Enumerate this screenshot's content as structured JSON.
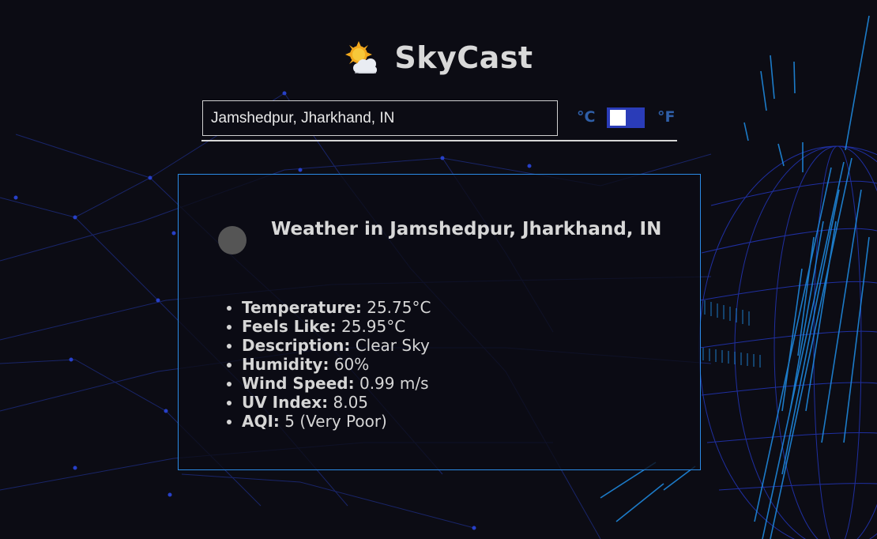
{
  "app": {
    "title": "SkyCast",
    "logo_icon": "sun-behind-cloud-icon"
  },
  "search": {
    "value": "Jamshedpur, Jharkhand, IN",
    "placeholder": ""
  },
  "units": {
    "celsius_label": "°C",
    "fahrenheit_label": "°F",
    "selected": "°C"
  },
  "weather": {
    "title": "Weather in Jamshedpur, Jharkhand, IN",
    "icon": "weather-condition-icon",
    "details": [
      {
        "label": "Temperature:",
        "value": "25.75°C"
      },
      {
        "label": "Feels Like:",
        "value": "25.95°C"
      },
      {
        "label": "Description:",
        "value": "Clear Sky"
      },
      {
        "label": "Humidity:",
        "value": "60%"
      },
      {
        "label": "Wind Speed:",
        "value": "0.99 m/s"
      },
      {
        "label": "UV Index:",
        "value": "8.05"
      },
      {
        "label": "AQI:",
        "value": "5 (Very Poor)"
      }
    ]
  },
  "colors": {
    "background": "#0c0c14",
    "accent": "#2b8be6",
    "toggle": "#2a3cb8",
    "unit_text": "#2f5fa8",
    "text": "#d6d6d6"
  }
}
